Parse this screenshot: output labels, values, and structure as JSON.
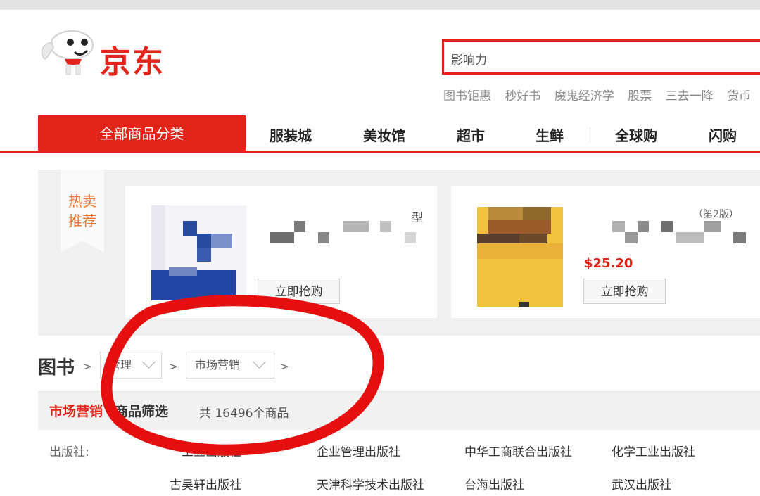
{
  "brand": {
    "name": "京东"
  },
  "search": {
    "value": "影响力"
  },
  "hot_words": [
    "图书钜惠",
    "秒好书",
    "魔鬼经济学",
    "股票",
    "三去一降",
    "货币"
  ],
  "nav": {
    "category_label": "全部商品分类",
    "items": [
      "服装城",
      "美妆馆",
      "超市",
      "生鲜",
      "全球购",
      "闪购"
    ]
  },
  "hot_sale": {
    "label": "热卖推荐",
    "products": [
      {
        "title": "型",
        "buy_label": "立即抢购"
      },
      {
        "title": "（第2版）",
        "price": "$25.20",
        "buy_label": "立即抢购"
      }
    ]
  },
  "breadcrumb": {
    "root": "图书",
    "separator": ">",
    "levels": [
      "管理",
      "市场营销"
    ]
  },
  "filter": {
    "category": "市场营销",
    "title": "商品筛选",
    "count": "共 16496个商品"
  },
  "publishers": {
    "label": "出版社:",
    "row1": [
      "工业出版社",
      "企业管理出版社",
      "中华工商联合出版社",
      "化学工业出版社"
    ],
    "row2": [
      "古吴轩出版社",
      "天津科学技术出版社",
      "台海出版社",
      "武汉出版社"
    ]
  },
  "colors": {
    "brand_red": "#e1251b",
    "hot_orange": "#e8722b",
    "annotation_red": "#e60f0f"
  },
  "icons": [
    "jd-mascot-icon",
    "chevron-down-icon"
  ]
}
